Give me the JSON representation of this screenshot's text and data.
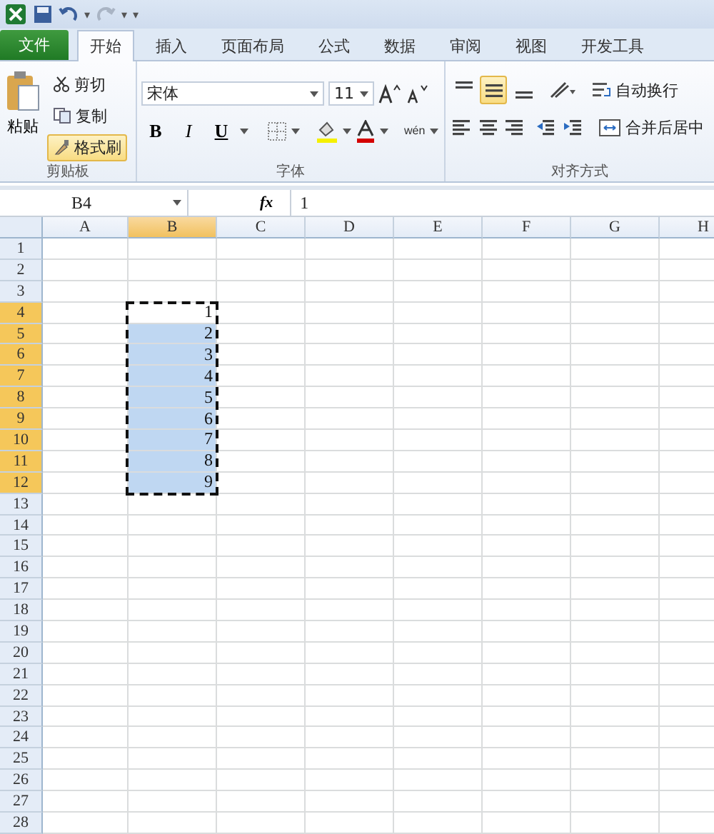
{
  "quick_access": {
    "undo_caret": "▾",
    "redo_caret": "▾",
    "customize": "▾"
  },
  "tabs": [
    {
      "label": "文件",
      "kind": "file",
      "selected": false
    },
    {
      "label": "开始",
      "kind": "tab",
      "selected": true
    },
    {
      "label": "插入",
      "kind": "tab",
      "selected": false
    },
    {
      "label": "页面布局",
      "kind": "tab",
      "selected": false
    },
    {
      "label": "公式",
      "kind": "tab",
      "selected": false
    },
    {
      "label": "数据",
      "kind": "tab",
      "selected": false
    },
    {
      "label": "审阅",
      "kind": "tab",
      "selected": false
    },
    {
      "label": "视图",
      "kind": "tab",
      "selected": false
    },
    {
      "label": "开发工具",
      "kind": "tab",
      "selected": false
    }
  ],
  "clipboard": {
    "label": "剪贴板",
    "paste": "粘贴",
    "cut": "剪切",
    "copy": "复制",
    "format_painter": {
      "label": "格式刷",
      "active": true
    }
  },
  "font": {
    "label": "字体",
    "name": "宋体",
    "size": "11",
    "bold": "B",
    "italic": "I",
    "underline": "U",
    "phonetic": "wén"
  },
  "alignment": {
    "label": "对齐方式",
    "vertical": [
      {
        "kind": "top",
        "selected": false
      },
      {
        "kind": "middle",
        "selected": true
      },
      {
        "kind": "bottom",
        "selected": false
      }
    ],
    "wrap_text": "自动换行",
    "merge_center": "合并后居中"
  },
  "formula_bar": {
    "name_box": "B4",
    "fx": "fx",
    "value": "1"
  },
  "sheet": {
    "marquee": true,
    "columns": [
      {
        "label": "A",
        "selected": false
      },
      {
        "label": "B",
        "selected": true
      },
      {
        "label": "C",
        "selected": false
      },
      {
        "label": "D",
        "selected": false
      },
      {
        "label": "E",
        "selected": false
      },
      {
        "label": "F",
        "selected": false
      },
      {
        "label": "G",
        "selected": false
      },
      {
        "label": "H",
        "selected": false
      }
    ],
    "rows": [
      {
        "header": "1",
        "selected": false,
        "cells": []
      },
      {
        "header": "2",
        "selected": false,
        "cells": []
      },
      {
        "header": "3",
        "selected": false,
        "cells": []
      },
      {
        "header": "4",
        "selected": true,
        "cells": [
          {
            "selected": false
          },
          {
            "value": "1",
            "active": true,
            "selected": true
          }
        ]
      },
      {
        "header": "5",
        "selected": true,
        "cells": [
          {
            "selected": false
          },
          {
            "value": "2",
            "active": false,
            "selected": true
          }
        ]
      },
      {
        "header": "6",
        "selected": true,
        "cells": [
          {
            "selected": false
          },
          {
            "value": "3",
            "active": false,
            "selected": true
          }
        ]
      },
      {
        "header": "7",
        "selected": true,
        "cells": [
          {
            "selected": false
          },
          {
            "value": "4",
            "active": false,
            "selected": true
          }
        ]
      },
      {
        "header": "8",
        "selected": true,
        "cells": [
          {
            "selected": false
          },
          {
            "value": "5",
            "active": false,
            "selected": true
          }
        ]
      },
      {
        "header": "9",
        "selected": true,
        "cells": [
          {
            "selected": false
          },
          {
            "value": "6",
            "active": false,
            "selected": true
          }
        ]
      },
      {
        "header": "10",
        "selected": true,
        "cells": [
          {
            "selected": false
          },
          {
            "value": "7",
            "active": false,
            "selected": true
          }
        ]
      },
      {
        "header": "11",
        "selected": true,
        "cells": [
          {
            "selected": false
          },
          {
            "value": "8",
            "active": false,
            "selected": true
          }
        ]
      },
      {
        "header": "12",
        "selected": true,
        "cells": [
          {
            "selected": false
          },
          {
            "value": "9",
            "active": false,
            "selected": true
          }
        ]
      },
      {
        "header": "13",
        "selected": false,
        "cells": []
      },
      {
        "header": "14",
        "selected": false,
        "cells": []
      },
      {
        "header": "15",
        "selected": false,
        "cells": []
      },
      {
        "header": "16",
        "selected": false,
        "cells": []
      },
      {
        "header": "17",
        "selected": false,
        "cells": []
      },
      {
        "header": "18",
        "selected": false,
        "cells": []
      },
      {
        "header": "19",
        "selected": false,
        "cells": []
      },
      {
        "header": "20",
        "selected": false,
        "cells": []
      },
      {
        "header": "21",
        "selected": false,
        "cells": []
      },
      {
        "header": "22",
        "selected": false,
        "cells": []
      },
      {
        "header": "23",
        "selected": false,
        "cells": []
      },
      {
        "header": "24",
        "selected": false,
        "cells": []
      },
      {
        "header": "25",
        "selected": false,
        "cells": []
      },
      {
        "header": "26",
        "selected": false,
        "cells": []
      },
      {
        "header": "27",
        "selected": false,
        "cells": []
      },
      {
        "header": "28",
        "selected": false,
        "cells": []
      }
    ]
  }
}
